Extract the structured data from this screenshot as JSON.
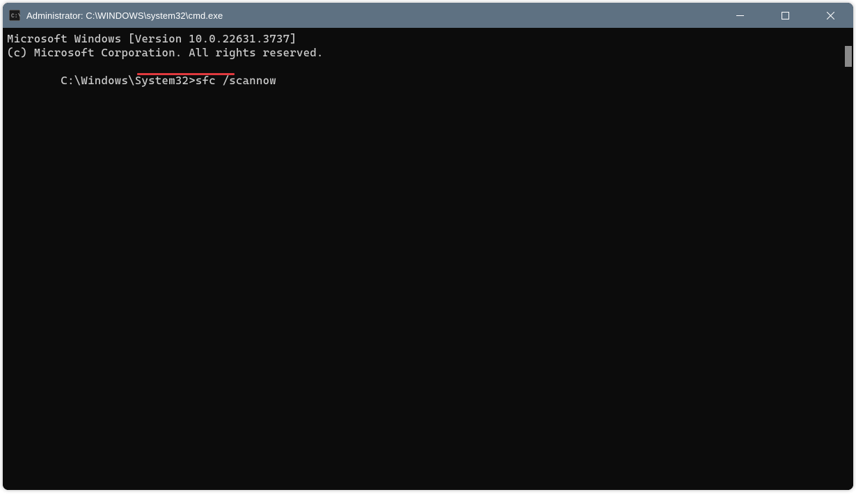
{
  "titlebar": {
    "title": "Administrator: C:\\WINDOWS\\system32\\cmd.exe"
  },
  "terminal": {
    "line1": "Microsoft Windows [Version 10.0.22631.3737]",
    "line2": "(c) Microsoft Corporation. All rights reserved.",
    "blank": "",
    "prompt": "C:\\Windows\\System32>",
    "command": "sfc /scannow"
  },
  "annotation": {
    "underline_color": "#e0393e"
  },
  "colors": {
    "titlebar_bg": "#5e7182",
    "terminal_bg": "#0c0c0c",
    "terminal_fg": "#cccccc"
  }
}
